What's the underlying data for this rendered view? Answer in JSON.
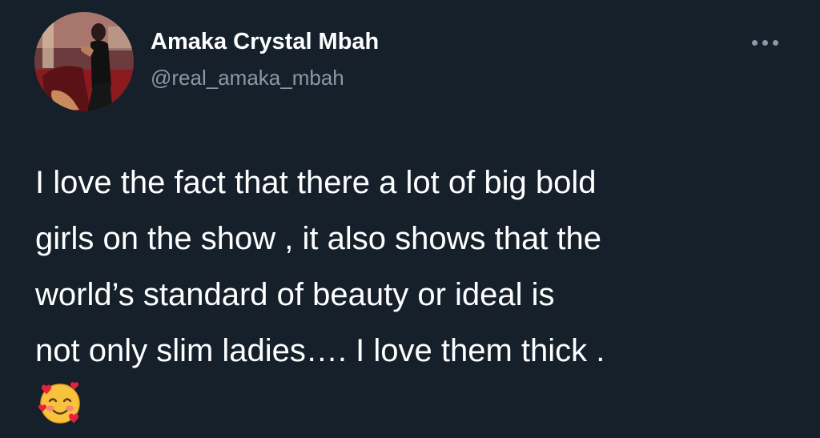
{
  "tweet": {
    "author": {
      "display_name": "Amaka Crystal Mbah",
      "handle": "@real_amaka_mbah",
      "avatar_icon": "profile-photo"
    },
    "more_icon": "more-options-icon",
    "text": "I love the fact that there a lot of big bold\ngirls on the show , it also shows that the\nworld’s standard of beauty or ideal is\nnot only slim ladies…. I love them thick .",
    "emoji_icon": "smiling-face-with-hearts-emoji"
  },
  "colors": {
    "background": "#15202b",
    "primary_text": "#ffffff",
    "secondary_text": "#8b98a5"
  }
}
